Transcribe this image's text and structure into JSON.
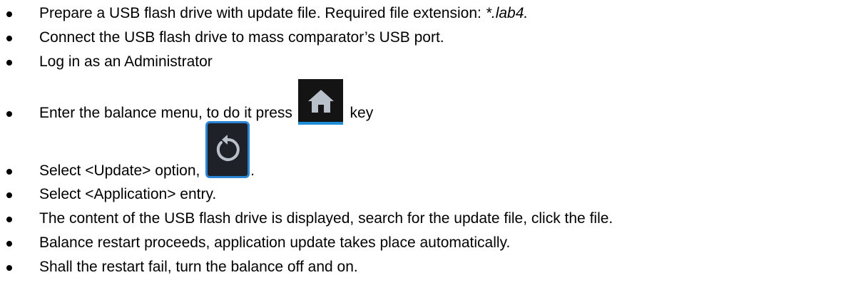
{
  "steps": [
    {
      "before": "Prepare a USB flash drive with update file. Required file extension: ",
      "ext": "*.lab4."
    },
    {
      "text": "Connect the USB flash drive to mass comparator’s USB port."
    },
    {
      "text": "Log in as an Administrator"
    },
    {
      "before": "Enter the balance menu, to do it press ",
      "after": " key",
      "icon": "home-icon"
    },
    {
      "before": "Select <Update> option, ",
      "after": ".",
      "icon": "update-icon"
    },
    {
      "text": "Select <Application> entry."
    },
    {
      "text": "The content of the USB flash drive is displayed, search for the update file, click the file."
    },
    {
      "text": "Balance restart proceeds, application update takes place automatically."
    },
    {
      "text": "Shall the restart fail, turn the balance off and on."
    }
  ],
  "colors": {
    "home_key_bg": "#141414",
    "home_key_accent": "#1e8fd6",
    "update_key_bg": "#1e2228",
    "update_key_border": "#2a86d4",
    "icon_glyph": "#b9c0c9"
  }
}
